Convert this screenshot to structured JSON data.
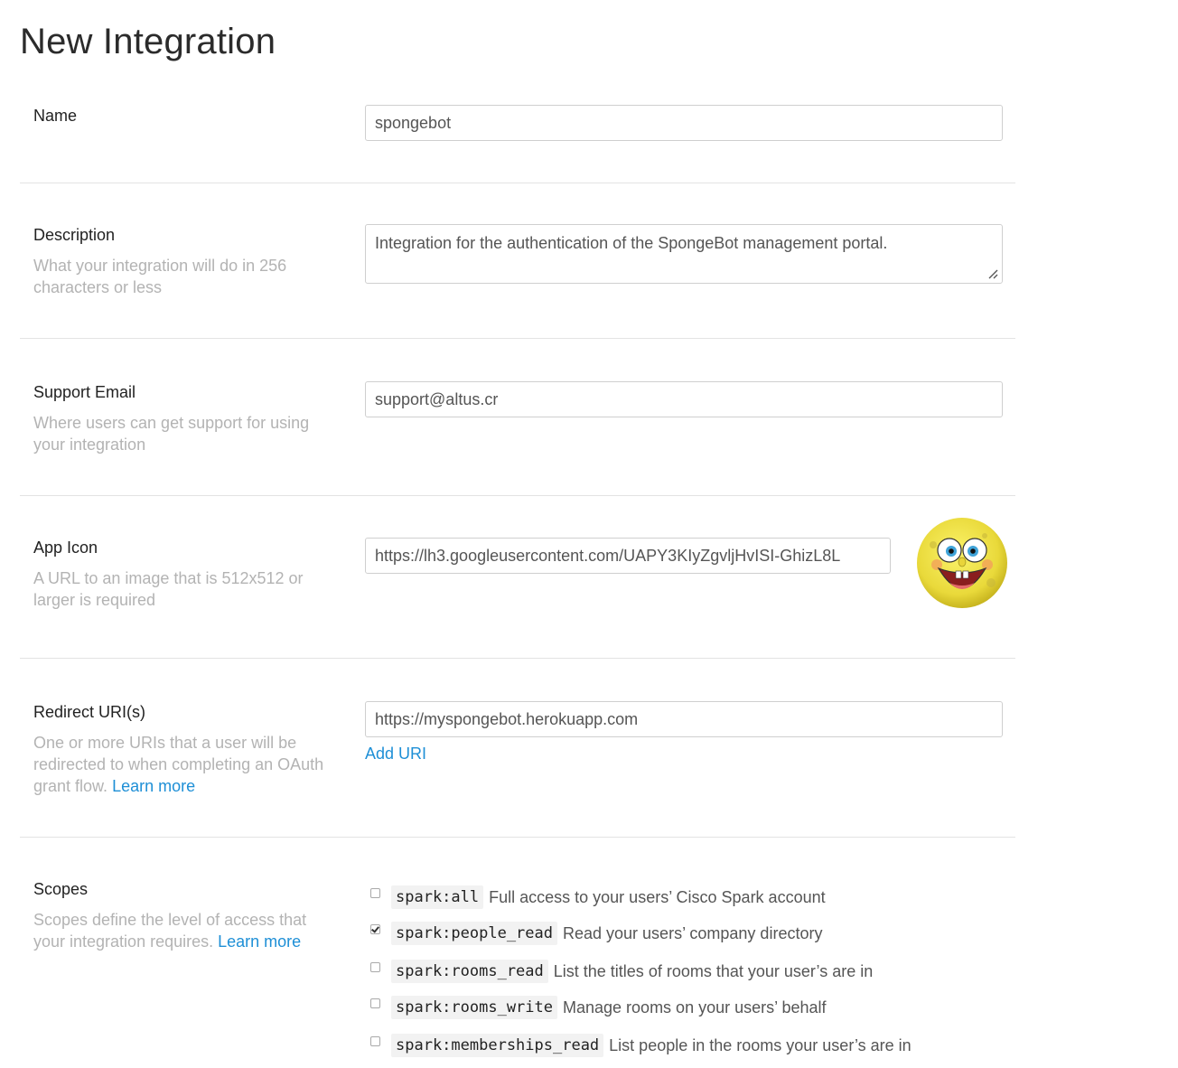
{
  "page": {
    "title": "New Integration"
  },
  "name": {
    "label": "Name",
    "value": "spongebot"
  },
  "description": {
    "label": "Description",
    "help": "What your integration will do in 256 characters or less",
    "value": "Integration for the authentication of the SpongeBot management portal."
  },
  "support_email": {
    "label": "Support Email",
    "help": "Where users can get support for using your integration",
    "value": "support@altus.cr"
  },
  "app_icon": {
    "label": "App Icon",
    "help": "A URL to an image that is 512x512 or larger is required",
    "value": "https://lh3.googleusercontent.com/UAPY3KIyZgvljHvISI-GhizL8L",
    "preview_icon": "spongebob-face-icon"
  },
  "redirect_uris": {
    "label": "Redirect URI(s)",
    "help": "One or more URIs that a user will be redirected to when completing an OAuth grant flow.",
    "learn_more": "Learn more",
    "value": "https://myspongebot.herokuapp.com",
    "add_uri": "Add URI"
  },
  "scopes": {
    "label": "Scopes",
    "help": "Scopes define the level of access that your integration requires.",
    "learn_more": "Learn more",
    "items": [
      {
        "code": "spark:all",
        "desc": "Full access to your users’ Cisco Spark account",
        "checked": false
      },
      {
        "code": "spark:people_read",
        "desc": "Read your users’ company directory",
        "checked": true
      },
      {
        "code": "spark:rooms_read",
        "desc": "List the titles of rooms that your user’s are in",
        "checked": false
      },
      {
        "code": "spark:rooms_write",
        "desc": "Manage rooms on your users’ behalf",
        "checked": false
      },
      {
        "code": "spark:memberships_read",
        "desc": "List people in the rooms your user’s are in",
        "checked": false
      }
    ]
  },
  "colors": {
    "link": "#1e8fd6",
    "help_text": "#b3b3b3",
    "border": "#cfcfcf"
  }
}
